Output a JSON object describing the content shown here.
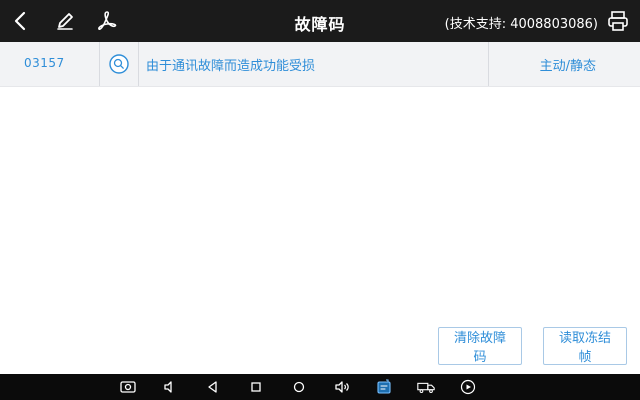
{
  "header": {
    "title": "故障码",
    "support_text": "(技术支持: 4008803086)"
  },
  "dtc": {
    "code": "03157",
    "description": "由于通讯故障而造成功能受损",
    "status": "主动/静态"
  },
  "buttons": {
    "clear_label": "清除故障码",
    "freeze_label": "读取冻结帧"
  }
}
